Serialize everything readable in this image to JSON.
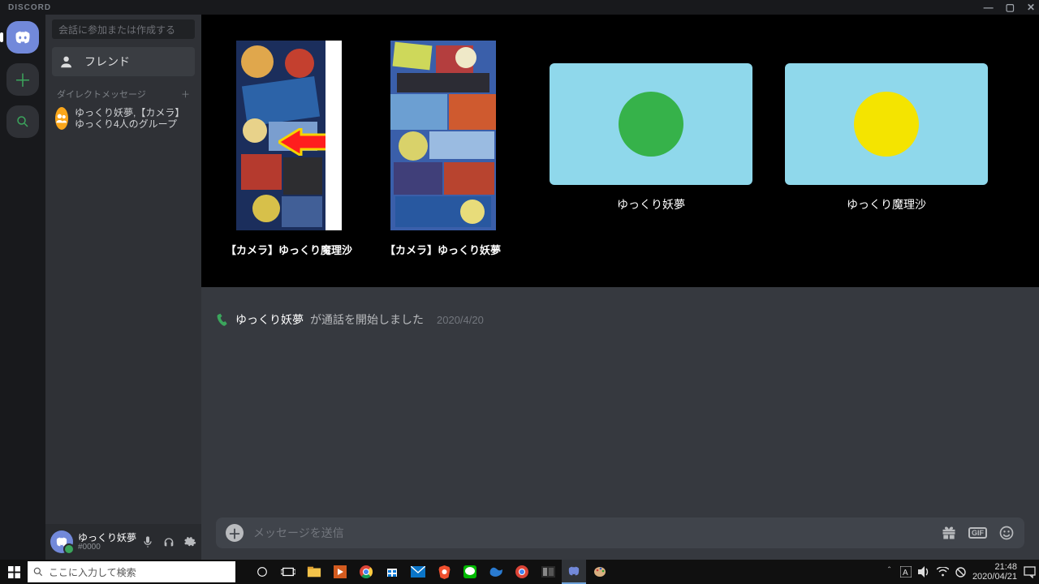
{
  "app_title": "DISCORD",
  "window": {
    "min": "—",
    "max": "▢",
    "close": "✕"
  },
  "find_conv_placeholder": "会話に参加または作成する",
  "friends_label": "フレンド",
  "dm_header": "ダイレクトメッセージ",
  "dm_group": {
    "line": "ゆっくり妖夢,【カメラ】ゆっくり4人のグループ"
  },
  "user": {
    "name": "ゆっくり妖夢",
    "tag": "#0000"
  },
  "stage": {
    "cam1_label": "【カメラ】ゆっくり魔理沙",
    "cam2_label": "【カメラ】ゆっくり妖夢",
    "tile1_label": "ゆっくり妖夢",
    "tile2_label": "ゆっくり魔理沙"
  },
  "call": {
    "name": "ゆっくり妖夢",
    "text": " が通話を開始しました",
    "date": "2020/4/20"
  },
  "composer_placeholder": "メッセージを送信",
  "gif": "GIF",
  "taskbar": {
    "search_placeholder": "ここに入力して検索",
    "time": "21:48",
    "date": "2020/04/21"
  },
  "colors": {
    "tile_bg": "#8fd8eb",
    "circle_green": "#36b24a",
    "circle_yellow": "#f4e400"
  }
}
